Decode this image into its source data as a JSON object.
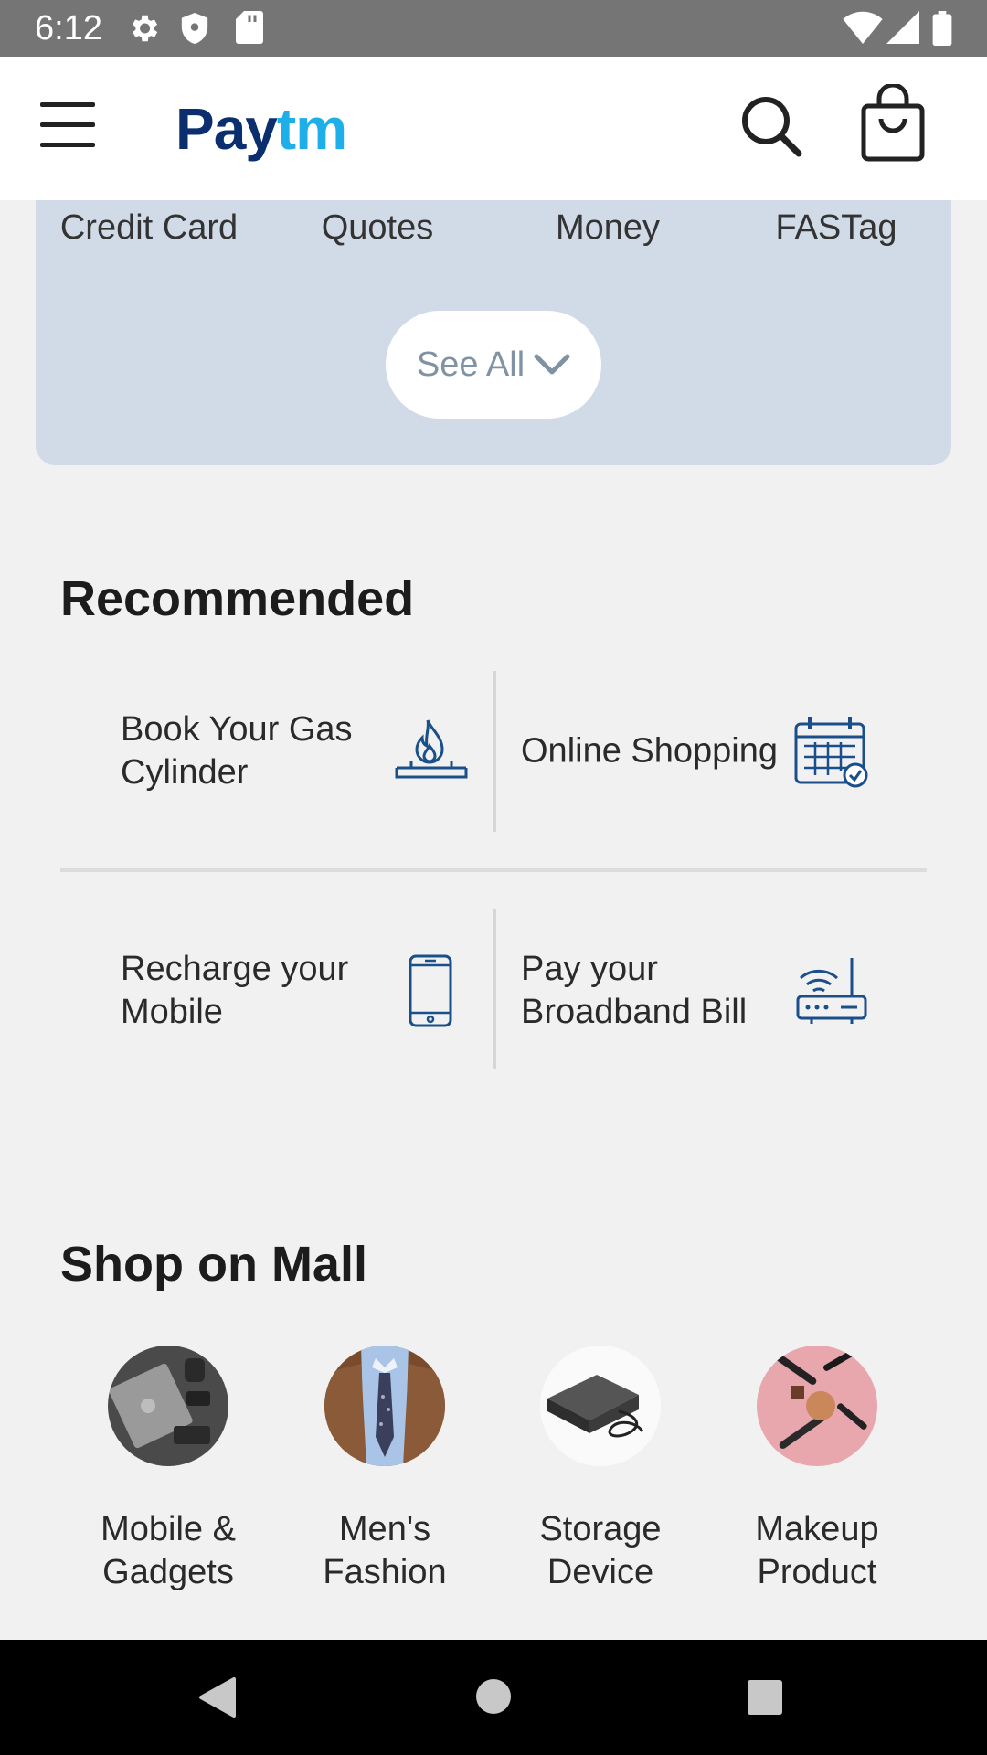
{
  "status_bar": {
    "time": "6:12"
  },
  "app": {
    "logo_part1": "Pay",
    "logo_part2": "tm",
    "brand_dark": "#0b2e6e",
    "brand_light": "#1eaee8"
  },
  "services": {
    "labels": [
      "Credit Card",
      "Quotes",
      "Money",
      "FASTag"
    ],
    "see_all": "See All",
    "card_color": "#d1dae7"
  },
  "recommended": {
    "title": "Recommended",
    "items": [
      {
        "label": "Book Your Gas Cylinder",
        "icon": "gas-cylinder-icon"
      },
      {
        "label": "Online Shopping",
        "icon": "calendar-check-icon"
      },
      {
        "label": "Recharge your Mobile",
        "icon": "mobile-phone-icon"
      },
      {
        "label": "Pay your Broadband Bill",
        "icon": "wifi-router-icon"
      }
    ]
  },
  "mall": {
    "title": "Shop on Mall",
    "items": [
      {
        "label": "Mobile & Gadgets"
      },
      {
        "label": "Men's Fashion"
      },
      {
        "label": "Storage Device"
      },
      {
        "label": "Makeup Product"
      }
    ]
  },
  "icon_color": "#1b4f8a"
}
